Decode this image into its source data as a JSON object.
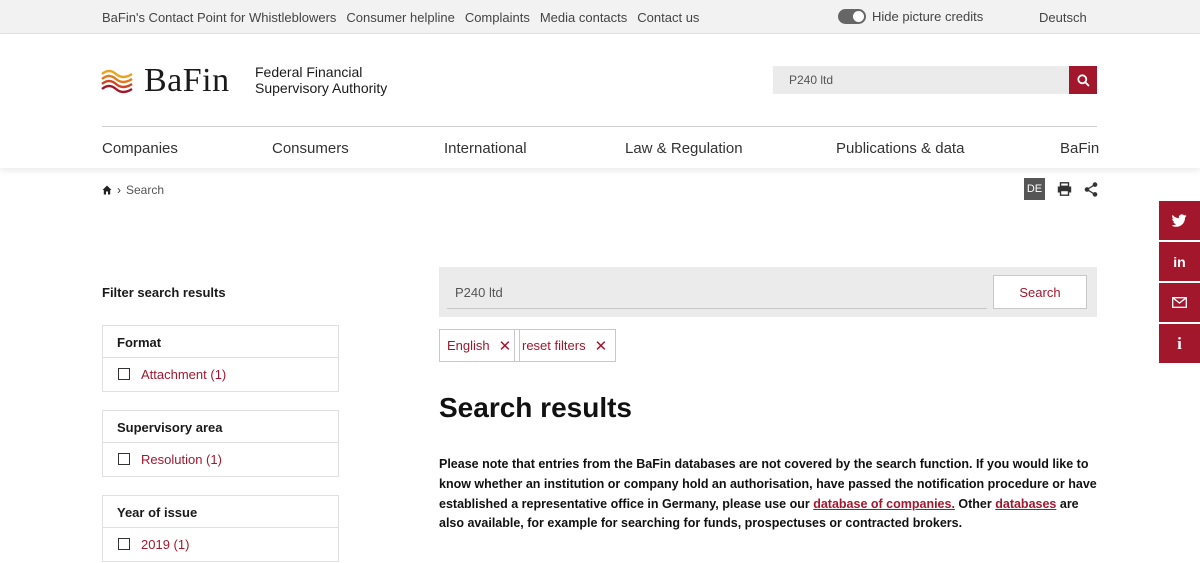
{
  "topbar": {
    "links": [
      "BaFin's Contact Point for Whistleblowers",
      "Consumer helpline",
      "Complaints",
      "Media contacts",
      "Contact us"
    ],
    "credits_label": "Hide picture credits",
    "language": "Deutsch"
  },
  "header": {
    "logo_name": "BaFin",
    "logo_sub_line1": "Federal Financial",
    "logo_sub_line2": "Supervisory Authority",
    "search_value": "P240 ltd"
  },
  "nav": {
    "items": [
      "Companies",
      "Consumers",
      "International",
      "Law & Regulation",
      "Publications & data",
      "BaFin"
    ]
  },
  "breadcrumb": {
    "current": "Search"
  },
  "tools": {
    "lang_badge": "DE"
  },
  "filters": {
    "title": "Filter search results",
    "groups": [
      {
        "heading": "Format",
        "item": "Attachment (1)"
      },
      {
        "heading": "Supervisory area",
        "item": "Resolution (1)"
      },
      {
        "heading": "Year of issue",
        "item": "2019 (1)"
      }
    ]
  },
  "search": {
    "input_value": "P240 ltd",
    "button_label": "Search"
  },
  "chips": [
    {
      "label": "English"
    },
    {
      "label": "reset filters"
    }
  ],
  "results": {
    "title": "Search results",
    "notice_part1": "Please note that entries from the BaFin databases are not covered by the search function. If you would like to know whether an institution or company hold an authorisation, have passed the notification procedure or have established a representative office in Germany, please use our ",
    "notice_link1": "database of companies.",
    "notice_part2": " Other ",
    "notice_link2": "databases",
    "notice_part3": " are also available, for example for searching for funds, prospectuses or contracted brokers."
  },
  "colors": {
    "accent": "#a3172d",
    "topbar_bg": "#f2f2f2"
  }
}
